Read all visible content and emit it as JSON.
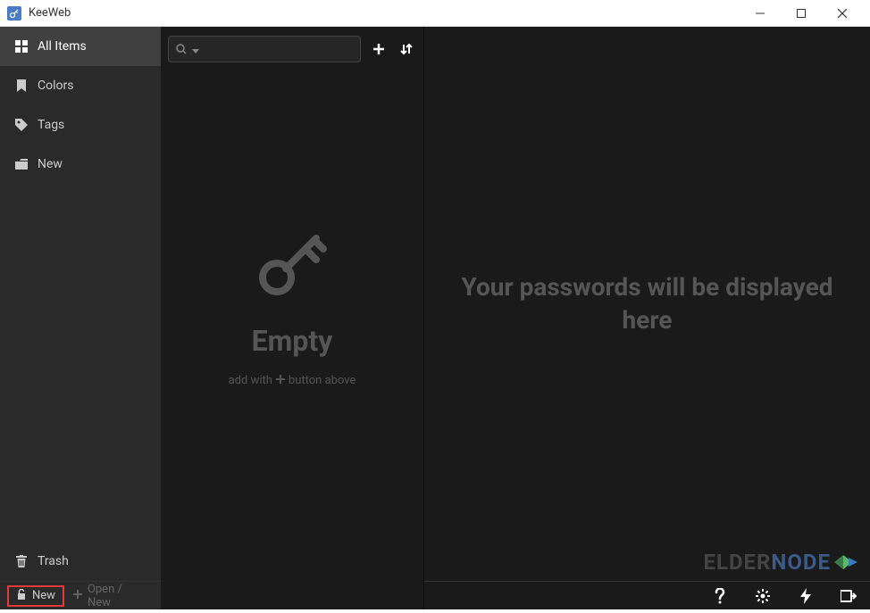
{
  "window": {
    "title": "KeeWeb"
  },
  "sidebar": {
    "items": [
      {
        "label": "All Items",
        "active": true
      },
      {
        "label": "Colors",
        "active": false
      },
      {
        "label": "Tags",
        "active": false
      },
      {
        "label": "New",
        "active": false
      }
    ],
    "trash_label": "Trash"
  },
  "footer": {
    "new_tab": "New",
    "open_new": "Open / New"
  },
  "search": {
    "placeholder": ""
  },
  "middle": {
    "empty_title": "Empty",
    "empty_hint_before": "add with",
    "empty_hint_after": "button above"
  },
  "right": {
    "message": "Your passwords will be displayed here"
  },
  "watermark": {
    "prefix": "ELDER",
    "suffix": "NODE"
  }
}
